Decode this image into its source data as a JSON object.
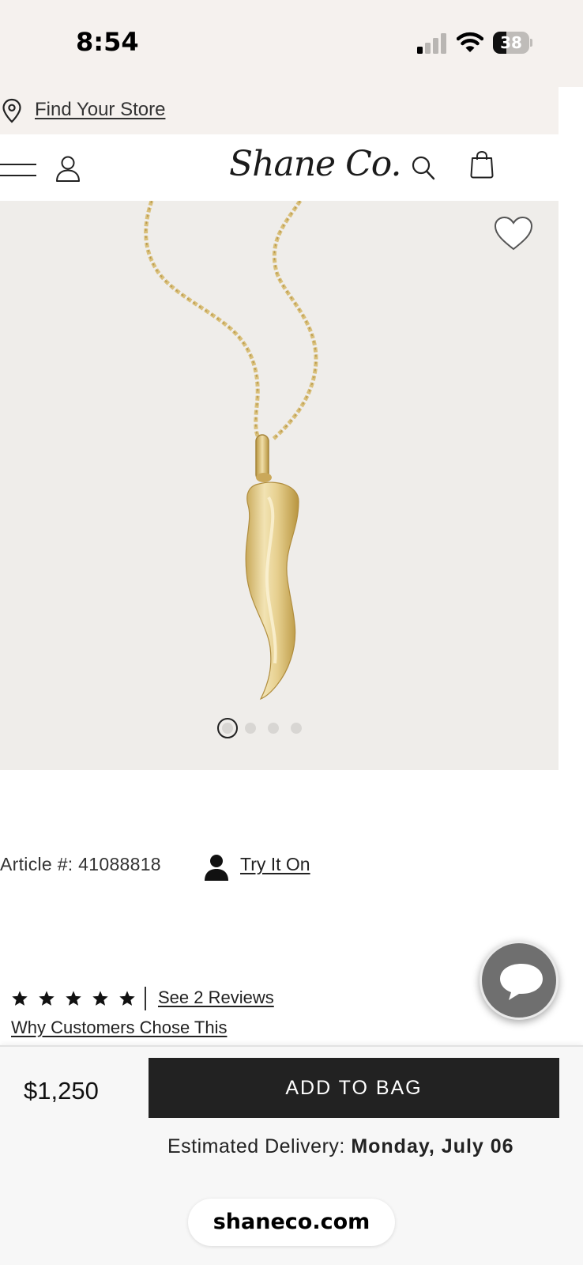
{
  "status_bar": {
    "time": "8:54",
    "battery_percent": "38",
    "battery_level": 0.38
  },
  "store_bar": {
    "find_store_label": "Find Your Store",
    "icon": "location-pin-icon"
  },
  "header": {
    "logo_text": "Shane Co.",
    "icons": [
      "menu-icon",
      "account-icon",
      "search-icon",
      "shopping-bag-icon"
    ]
  },
  "product_gallery": {
    "favorite_icon": "heart-icon",
    "image_count": 4,
    "active_index": 0
  },
  "product_info": {
    "article_label": "Article #: 41088818",
    "try_on_label": "Try It On",
    "rating": 5,
    "reviews_link": "See 2 Reviews",
    "why_link": "Why Customers Chose This"
  },
  "purchase": {
    "price": "$1,250",
    "add_to_bag_label": "ADD TO BAG",
    "delivery_label": "Estimated Delivery:",
    "delivery_date": "Monday, July 06"
  },
  "browser": {
    "url": "shaneco.com"
  },
  "colors": {
    "accent_dark": "#222222",
    "page_bg": "#f5f1ee",
    "gold": "#e8d49a"
  }
}
